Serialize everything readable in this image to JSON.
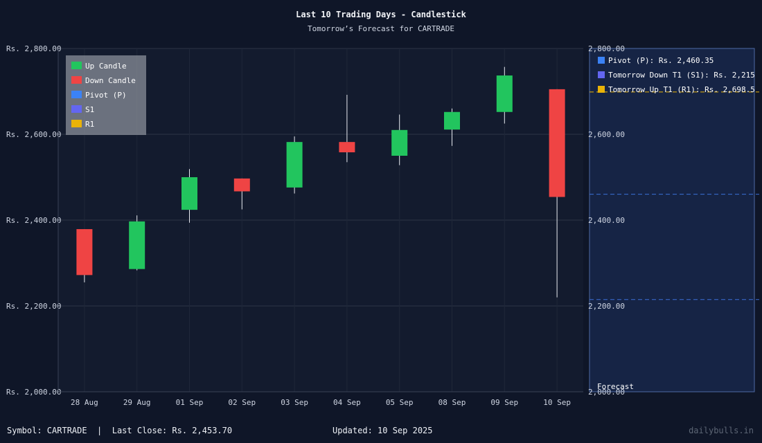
{
  "title": "Last 10 Trading Days - Candlestick",
  "subtitle": "Tomorrow’s Forecast for CARTRADE",
  "footer": {
    "symbol_text": "Symbol: CARTRADE  |  Last Close: Rs. 2,453.70",
    "updated_text": "Updated: 10 Sep 2025",
    "brand_text": "dailybulls.in"
  },
  "colors": {
    "up": "#22c55e",
    "down": "#ef4444",
    "pivot": "#3b82f6",
    "s1": "#6366f1",
    "r1": "#eab308",
    "grid": "#2c3446",
    "axis": "#cfd5e2",
    "forecast_line": "#3b6fd8"
  },
  "legend": {
    "items": [
      {
        "label": "Up Candle",
        "color": "#22c55e"
      },
      {
        "label": "Down Candle",
        "color": "#ef4444"
      },
      {
        "label": "Pivot (P)",
        "color": "#3b82f6"
      },
      {
        "label": "S1",
        "color": "#6366f1"
      },
      {
        "label": "R1",
        "color": "#eab308"
      }
    ]
  },
  "forecast_panel": {
    "label": "Forecast",
    "items": [
      {
        "label": "Pivot (P): Rs. 2,460.35",
        "color": "#3b82f6"
      },
      {
        "label": "Tomorrow Down T1 (S1): Rs. 2,215",
        "color": "#6366f1"
      },
      {
        "label": "Tomorrow Up T1 (R1): Rs. 2,698.5",
        "color": "#eab308"
      }
    ]
  },
  "chart_data": {
    "type": "candlestick",
    "title": "Last 10 Trading Days - Candlestick",
    "subtitle": "Tomorrow’s Forecast for CARTRADE",
    "categories": [
      "28 Aug",
      "29 Aug",
      "01 Sep",
      "02 Sep",
      "03 Sep",
      "04 Sep",
      "05 Sep",
      "08 Sep",
      "09 Sep",
      "10 Sep"
    ],
    "ylim": [
      2000,
      2800
    ],
    "yticks": [
      2000,
      2200,
      2400,
      2600,
      2800
    ],
    "yticks_left_labels": [
      "Rs. 2,000.00",
      "Rs. 2,200.00",
      "Rs. 2,400.00",
      "Rs. 2,600.00",
      "Rs. 2,800.00"
    ],
    "yticks_right_labels": [
      "2,000.00",
      "2,200.00",
      "2,400.00",
      "2,600.00",
      "2,800.00"
    ],
    "grid": true,
    "legend_position": "top-left",
    "candles": [
      {
        "date": "28 Aug",
        "open": 2379,
        "high": 2379,
        "low": 2255,
        "close": 2272
      },
      {
        "date": "29 Aug",
        "open": 2286,
        "high": 2411,
        "low": 2283,
        "close": 2397
      },
      {
        "date": "01 Sep",
        "open": 2424,
        "high": 2519,
        "low": 2394,
        "close": 2500
      },
      {
        "date": "02 Sep",
        "open": 2497,
        "high": 2497,
        "low": 2425,
        "close": 2467
      },
      {
        "date": "03 Sep",
        "open": 2476,
        "high": 2595,
        "low": 2462,
        "close": 2582
      },
      {
        "date": "04 Sep",
        "open": 2582,
        "high": 2692,
        "low": 2535,
        "close": 2558
      },
      {
        "date": "05 Sep",
        "open": 2550,
        "high": 2646,
        "low": 2528,
        "close": 2610
      },
      {
        "date": "08 Sep",
        "open": 2611,
        "high": 2660,
        "low": 2573,
        "close": 2652
      },
      {
        "date": "09 Sep",
        "open": 2652,
        "high": 2757,
        "low": 2625,
        "close": 2737
      },
      {
        "date": "10 Sep",
        "open": 2705,
        "high": 2705,
        "low": 2220,
        "close": 2454
      }
    ],
    "levels": [
      {
        "name": "Pivot (P)",
        "value": 2460.35
      },
      {
        "name": "S1",
        "value": 2215
      },
      {
        "name": "R1",
        "value": 2698.5
      }
    ]
  }
}
